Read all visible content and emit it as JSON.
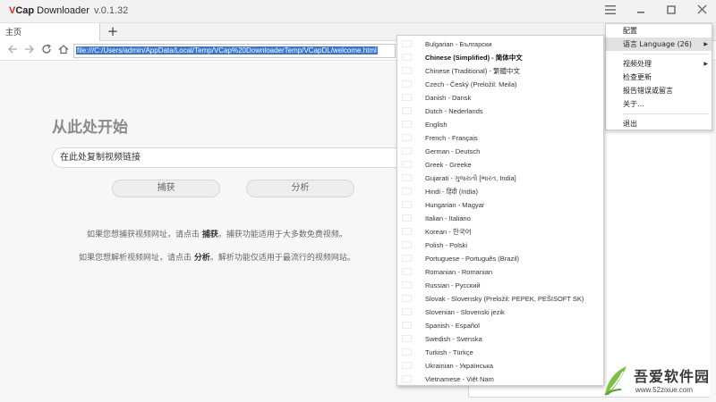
{
  "app": {
    "logo_v": "V",
    "logo_cap": "Cap",
    "logo_rest": " Downloader",
    "version": "v.0.1.32"
  },
  "tabs": [
    {
      "label": "主页"
    }
  ],
  "nav": {
    "url": "file:///C:/Users/admin/AppData/Local/Temp/VCap%20DownloaderTemp/VCapDL/welcome.html"
  },
  "welcome": {
    "heading": "从此处开始",
    "input_value": "在此处复制视频链接",
    "capture_button": "捕获",
    "analyze_button": "分析",
    "hint1_pre": "如果您想捕获视频网址，请点击 ",
    "hint1_bold": "捕获",
    "hint1_post": "。捕获功能适用于大多数免费视频。",
    "hint2_pre": "如果您想解析视频网址，请点击 ",
    "hint2_bold": "分析",
    "hint2_post": "。解析功能仅适用于最流行的视频网站。"
  },
  "main_menu": {
    "items": [
      {
        "label": "配置"
      },
      {
        "label": "语言 Language (26)",
        "highlighted": true,
        "submenu": true
      },
      {
        "label": "视频处理",
        "submenu": true
      },
      {
        "label": "检查更新"
      },
      {
        "label": "报告错误或留言"
      },
      {
        "label": "关于..."
      },
      {
        "label": "退出"
      }
    ]
  },
  "languages": [
    {
      "label": "Bulgarian - Български",
      "flag": "bg"
    },
    {
      "label": "Chinese (Simplified) - 简体中文",
      "flag": "cn",
      "selected": true
    },
    {
      "label": "Chinese (Traditional) - 繁體中文",
      "flag": "tw"
    },
    {
      "label": "Czech - Český (Preložil: Meila)",
      "flag": "cz"
    },
    {
      "label": "Danish - Dansk",
      "flag": "dk"
    },
    {
      "label": "Dutch - Nederlands",
      "flag": "nl"
    },
    {
      "label": "English",
      "flag": "gb"
    },
    {
      "label": "French - Français",
      "flag": "fr"
    },
    {
      "label": "German - Deutsch",
      "flag": "de"
    },
    {
      "label": "Greek - Greeke",
      "flag": "gr"
    },
    {
      "label": "Gujarati - ગુજરાતી [ભારત, India]",
      "flag": "in"
    },
    {
      "label": "Hindi - हिंदी (India)",
      "flag": "in"
    },
    {
      "label": "Hungarian - Magyar",
      "flag": "hu"
    },
    {
      "label": "Italian - Italiano",
      "flag": "it"
    },
    {
      "label": "Korean - 한국어",
      "flag": "kr"
    },
    {
      "label": "Polish - Polski",
      "flag": "pl"
    },
    {
      "label": "Portuguese - Português (Brazil)",
      "flag": "br"
    },
    {
      "label": "Romanian - Romanian",
      "flag": "ro"
    },
    {
      "label": "Russian - Русский",
      "flag": "ru"
    },
    {
      "label": "Slovak - Slovensky (Preložil: PEPEK, PEŠISOFT SK)",
      "flag": "sk"
    },
    {
      "label": "Slovenian - Slovenski jezik",
      "flag": "si"
    },
    {
      "label": "Spanish - Español",
      "flag": "es"
    },
    {
      "label": "Swedish - Svenska",
      "flag": "se"
    },
    {
      "label": "Turkish - Türkçe",
      "flag": "tr"
    },
    {
      "label": "Ukrainian - Українська",
      "flag": "ua"
    },
    {
      "label": "Vietnamese - Việt Nam",
      "flag": "vn"
    }
  ],
  "watermark": {
    "title": "吾爱软件园",
    "url": "www.52zixue.com"
  },
  "colors": {
    "accent_red": "#d9261c",
    "selection_blue": "#3875d7",
    "menu_highlight": "#e1e1e1",
    "watermark_green": "#7cc242"
  }
}
